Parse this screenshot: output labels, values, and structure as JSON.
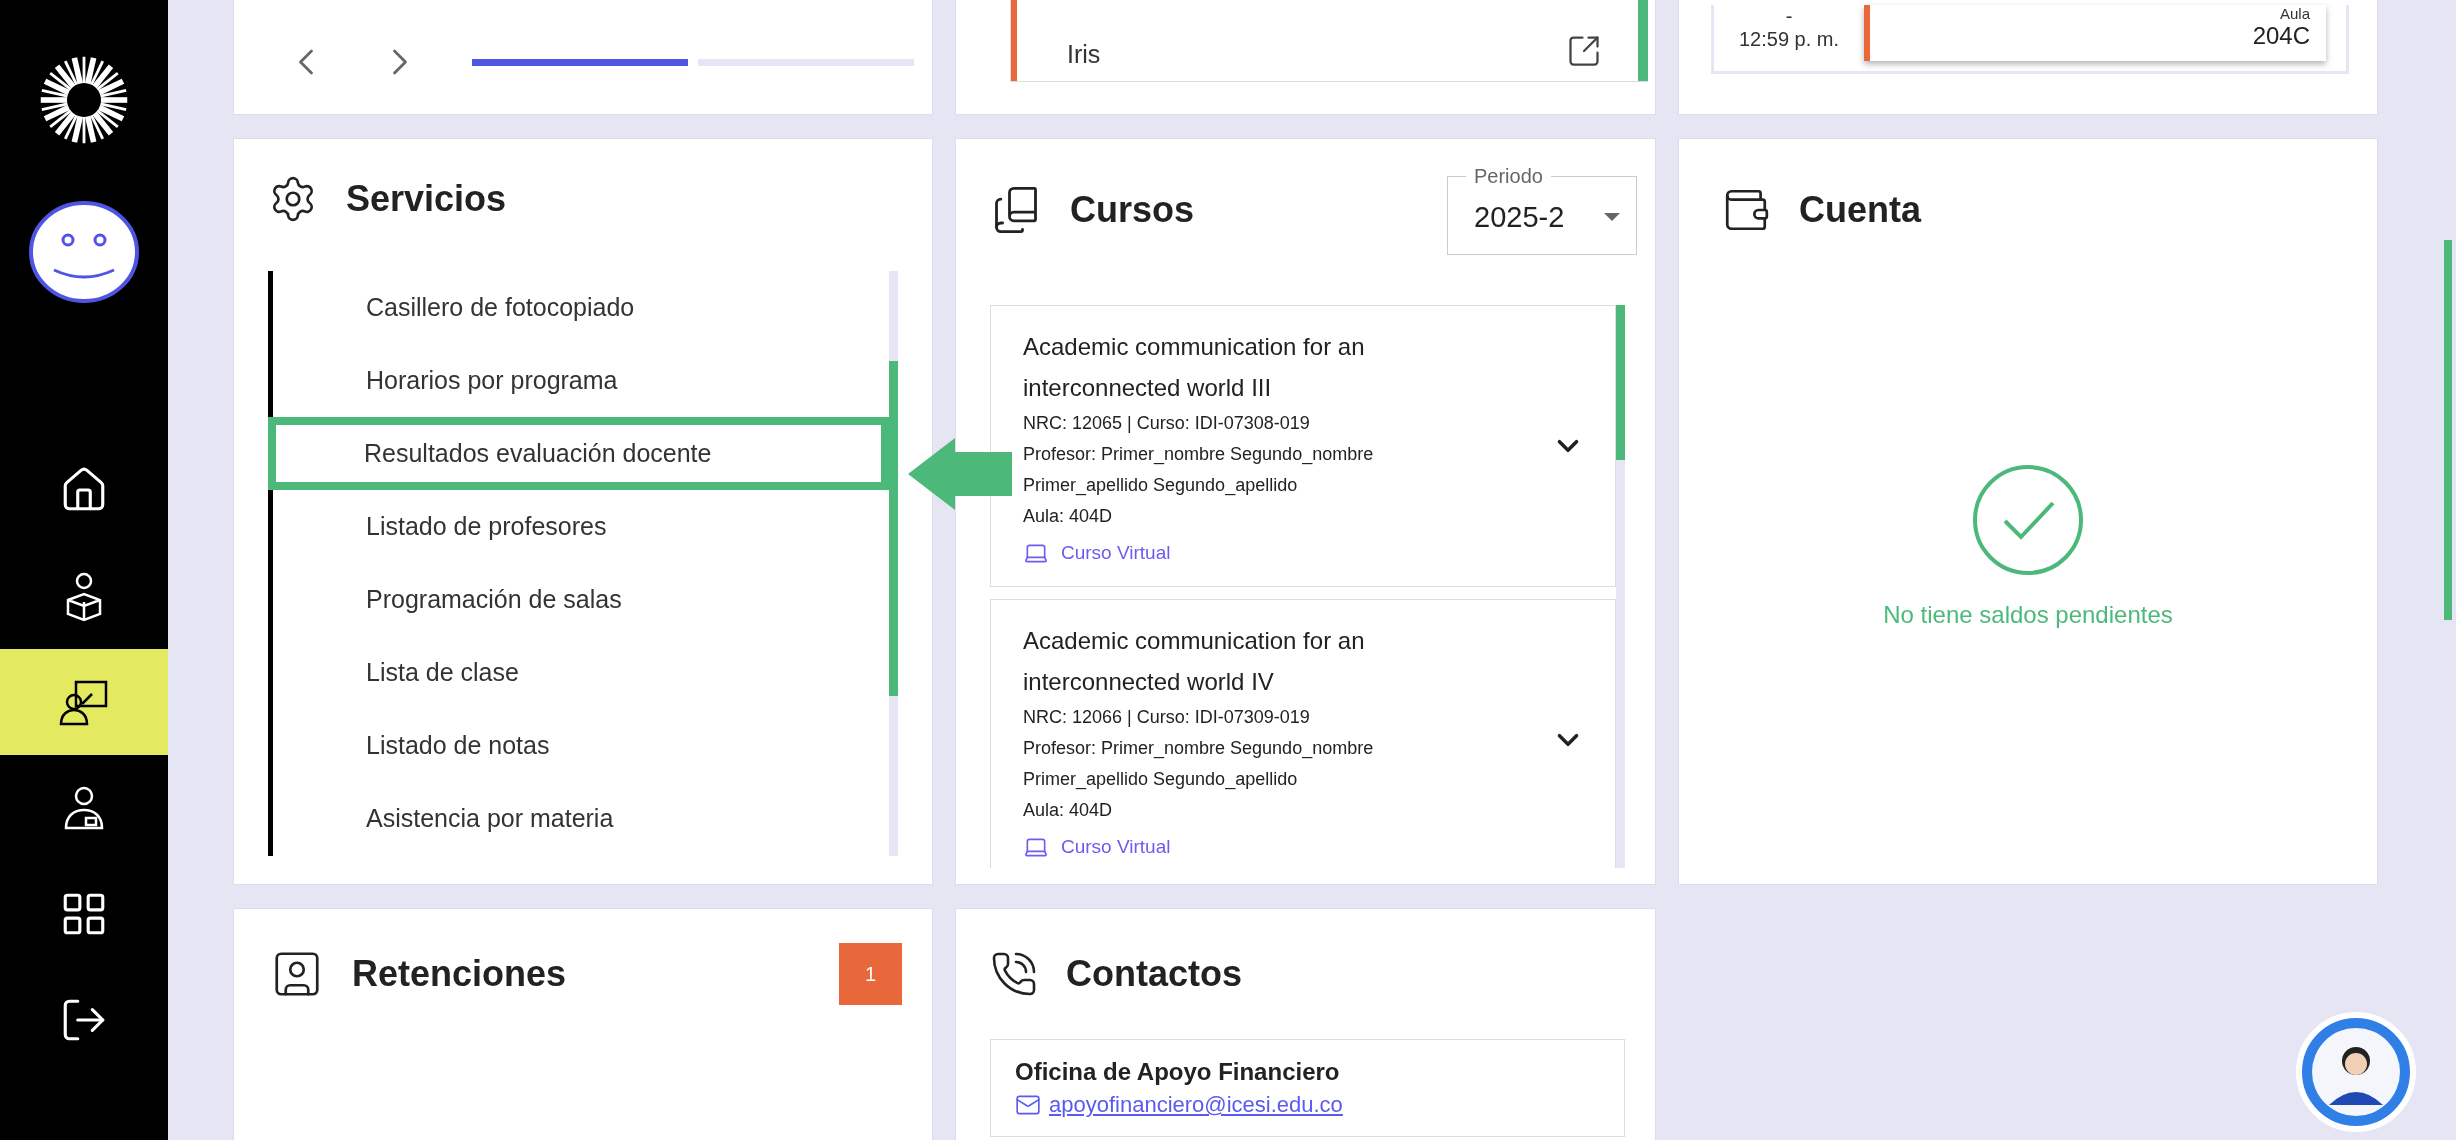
{
  "sidebar": {
    "items": [
      {
        "kind": "home",
        "selected": false
      },
      {
        "kind": "student",
        "selected": false
      },
      {
        "kind": "teacher",
        "selected": true
      },
      {
        "kind": "staff",
        "selected": false
      },
      {
        "kind": "apps",
        "selected": false
      },
      {
        "kind": "logout",
        "selected": false
      }
    ]
  },
  "carousel": {
    "pages": [
      {
        "selected": true
      },
      {
        "selected": false
      }
    ]
  },
  "links_card": {
    "items": [
      {
        "label": "Iris",
        "color": "#e9683b"
      }
    ]
  },
  "schedule_card": {
    "separator": "-",
    "end_time": "12:59 p. m.",
    "event": {
      "label": "Aula",
      "room": "204C",
      "color": "#e9683b"
    }
  },
  "servicios": {
    "title": "Servicios",
    "items": [
      {
        "label": "Casillero de fotocopiado",
        "highlighted": false
      },
      {
        "label": "Horarios por programa",
        "highlighted": false
      },
      {
        "label": "Resultados evaluación docente",
        "highlighted": true
      },
      {
        "label": "Listado de profesores",
        "highlighted": false
      },
      {
        "label": "Programación de salas",
        "highlighted": false
      },
      {
        "label": "Lista de clase",
        "highlighted": false
      },
      {
        "label": "Listado de notas",
        "highlighted": false
      },
      {
        "label": "Asistencia por materia",
        "highlighted": false
      }
    ]
  },
  "cursos": {
    "title": "Cursos",
    "period": {
      "label": "Periodo",
      "value": "2025-2"
    },
    "courses": [
      {
        "title": "Academic communication for an interconnected world III",
        "code": "NRC: 12065 | Curso: IDI-07308-019",
        "teacher": "Profesor: Primer_nombre Segundo_nombre Primer_apellido Segundo_apellido",
        "room": "Aula: 404D",
        "link": "Curso Virtual",
        "expanded": false
      },
      {
        "title": "Academic communication for an interconnected world IV",
        "code": "NRC: 12066 | Curso: IDI-07309-019",
        "teacher": "Profesor: Primer_nombre Segundo_nombre Primer_apellido Segundo_apellido",
        "room": "Aula: 404D",
        "link": "Curso Virtual",
        "expanded": false
      }
    ]
  },
  "cuenta": {
    "title": "Cuenta",
    "status": "No tiene saldos pendientes"
  },
  "retenciones": {
    "title": "Retenciones",
    "count": "1"
  },
  "contactos": {
    "title": "Contactos",
    "contacts": [
      {
        "name": "Oficina de Apoyo Financiero",
        "email": "apoyofinanciero@icesi.edu.co"
      }
    ]
  }
}
